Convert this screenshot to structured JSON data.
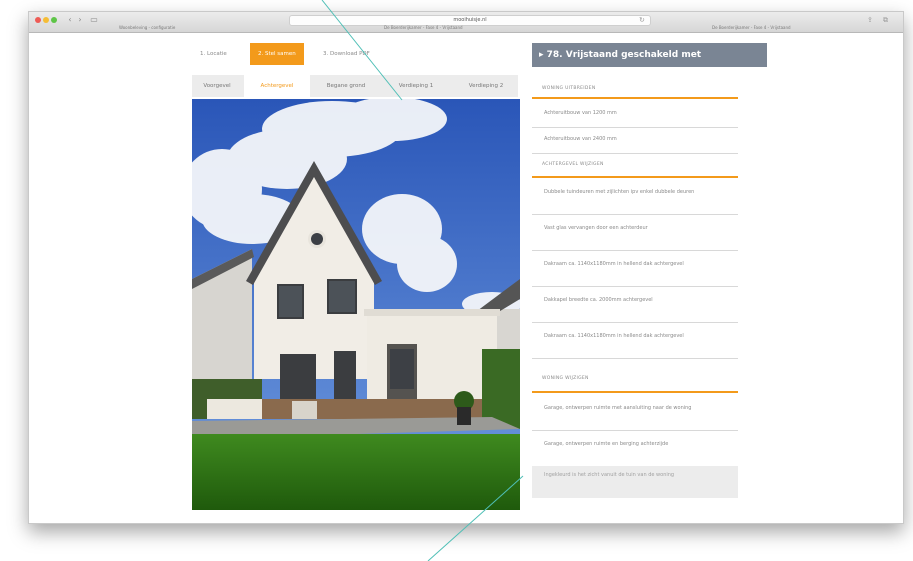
{
  "browser": {
    "address": "mooihuisje.nl",
    "tab_left": "Woonbeleving - configuratie",
    "tab_mid": "De Boerderijkamer - Fase 4 - Vrijstaand",
    "tab_right": "De Boerderijkamer - Fase 4 - Vrijstaand"
  },
  "steps": [
    "1. Locatie",
    "2. Stel samen",
    "3. Download PDF"
  ],
  "view_tabs": [
    "Voorgevel",
    "Achtergevel",
    "Begane grond",
    "Verdieping 1",
    "Verdieping 2"
  ],
  "active_view_tab": "Achtergevel",
  "panel": {
    "title": "▸ 78. Vrijstaand geschakeld met",
    "sections": [
      {
        "heading": "WONING UITBREIDEN",
        "options": [
          "Achteruitbouw van 1200 mm",
          "Achteruitbouw van 2400 mm"
        ]
      },
      {
        "heading": "ACHTERGEVEL WIJZIGEN",
        "options": [
          "Dubbele tuindeuren met zijlichten ipv enkel dubbele deuren",
          "Vast glas vervangen door een achterdeur",
          "Dakraam ca. 1140x1180mm in hellend dak achtergevel",
          "Dakkapel breedte ca. 2000mm achtergevel",
          "Dakraam ca. 1140x1180mm in hellend dak achtergevel"
        ]
      },
      {
        "heading": "WONING WIJZIGEN",
        "options": [
          "Garage, ontwerpen ruimte met aansluiting naar de woning",
          "Garage, ontwerpen ruimte en berging achterzijde"
        ]
      }
    ],
    "note": "Ingekleurd is het zicht vanuit de tuin van de woning"
  },
  "colors": {
    "accent": "#f39a1b",
    "title_bar": "#7a8594"
  }
}
